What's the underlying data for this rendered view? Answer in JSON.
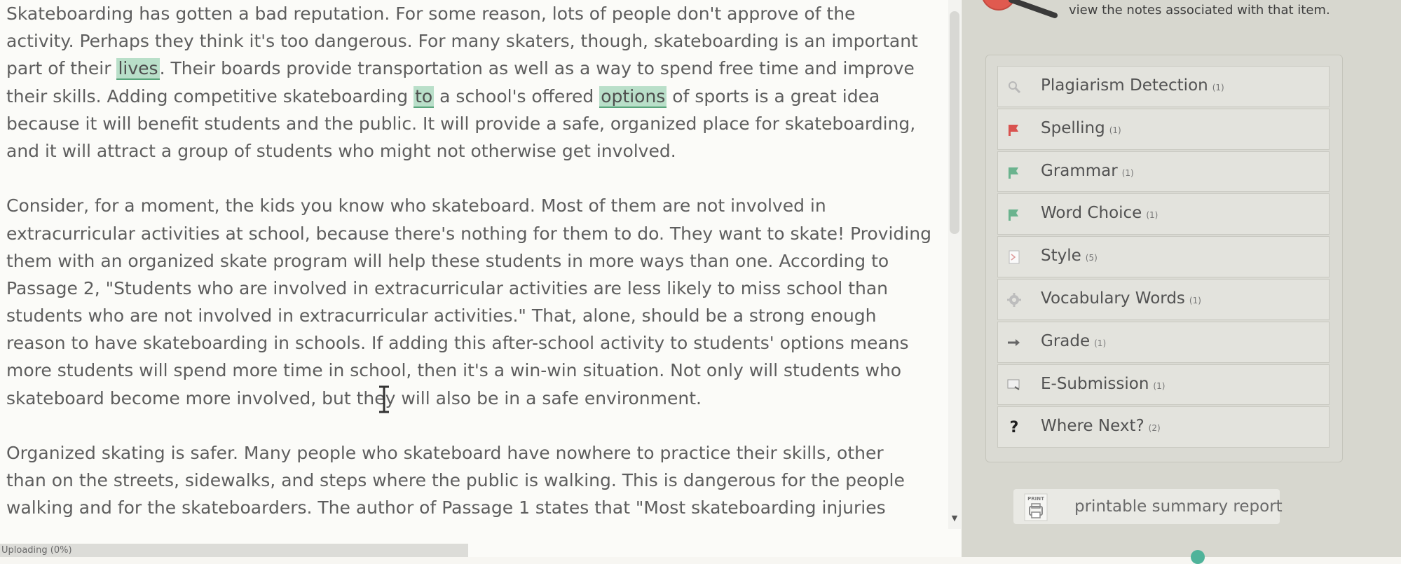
{
  "essay": {
    "paragraphs": [
      [
        [
          {
            "t": "Skateboarding has gotten a bad reputation.  For some reason, lots of people don't approve of the"
          }
        ],
        [
          {
            "t": "activity.  Perhaps they think it's too dangerous.  For many skaters, though, skateboarding is an important"
          }
        ],
        [
          {
            "t": "part of their "
          },
          {
            "t": "lives",
            "h": 1
          },
          {
            "t": ".  Their boards provide transportation as well as a way to spend free time and improve"
          }
        ],
        [
          {
            "t": "their skills. Adding competitive skateboarding "
          },
          {
            "t": "to",
            "h": 1
          },
          {
            "t": " a school's offered "
          },
          {
            "t": "options",
            "h": 1
          },
          {
            "t": " of sports is a great idea"
          }
        ],
        [
          {
            "t": "because it will benefit students and the public.  It will provide a safe, organized place for skateboarding,"
          }
        ],
        [
          {
            "t": "and it will attract a group of students who might not otherwise get involved."
          }
        ]
      ],
      [
        [
          {
            "t": "Consider, for a moment, the kids you know who skateboard.  Most of them are not involved in"
          }
        ],
        [
          {
            "t": "extracurricular activities at school, because there's nothing for them to do.  They want to skate! Providing"
          }
        ],
        [
          {
            "t": "them with an organized skate program will help these students in more ways than one.  According to"
          }
        ],
        [
          {
            "t": "Passage 2, \"Students who are involved in extracurricular activities are less likely to miss school than"
          }
        ],
        [
          {
            "t": "students who are not involved in extracurricular activities.\" That, alone, should be a strong enough"
          }
        ],
        [
          {
            "t": "reason to have skateboarding in schools.  If adding this after-school activity to students' options means"
          }
        ],
        [
          {
            "t": "more students will spend more time in school, then it's a win-win situation.  Not only will students who"
          }
        ],
        [
          {
            "t": "skateboard become more involved, but they will also be in a safe environment."
          }
        ]
      ],
      [
        [
          {
            "t": "Organized skating is safer.  Many people who skateboard have nowhere to practice their skills, other"
          }
        ],
        [
          {
            "t": "than on the streets, sidewalks, and steps where the public is walking.  This is dangerous for the people"
          }
        ],
        [
          {
            "t": "walking and for the skateboarders.  The author of Passage 1 states that \"Most skateboarding injuries"
          }
        ]
      ]
    ]
  },
  "status_bar": {
    "text": "Uploading (0%)"
  },
  "sidebar": {
    "hint": "view the notes associated with that item.",
    "tools": [
      {
        "label": "Plagiarism Detection",
        "count": "(1)",
        "icon": "magnifier-icon"
      },
      {
        "label": "Spelling",
        "count": "(1)",
        "icon": "red-flag-icon"
      },
      {
        "label": "Grammar",
        "count": "(1)",
        "icon": "green-flag-icon"
      },
      {
        "label": "Word Choice",
        "count": "(1)",
        "icon": "green-flag-icon"
      },
      {
        "label": "Style",
        "count": "(5)",
        "icon": "style-icon"
      },
      {
        "label": "Vocabulary Words",
        "count": "(1)",
        "icon": "gear-icon"
      },
      {
        "label": "Grade",
        "count": "(1)",
        "icon": "arrow-right-icon"
      },
      {
        "label": "E-Submission",
        "count": "(1)",
        "icon": "monitor-icon"
      },
      {
        "label": "Where Next?",
        "count": "(2)",
        "icon": "question-icon"
      }
    ],
    "print": {
      "icon_caption": "PRINT",
      "label": "printable summary report"
    }
  },
  "colors": {
    "highlight": "#b9dfc9",
    "highlight_underline": "#5aa57c",
    "sidebar_bg": "#d7d7cf",
    "spelling_flag": "#d9534f",
    "grammar_flag": "#6bb38e"
  }
}
